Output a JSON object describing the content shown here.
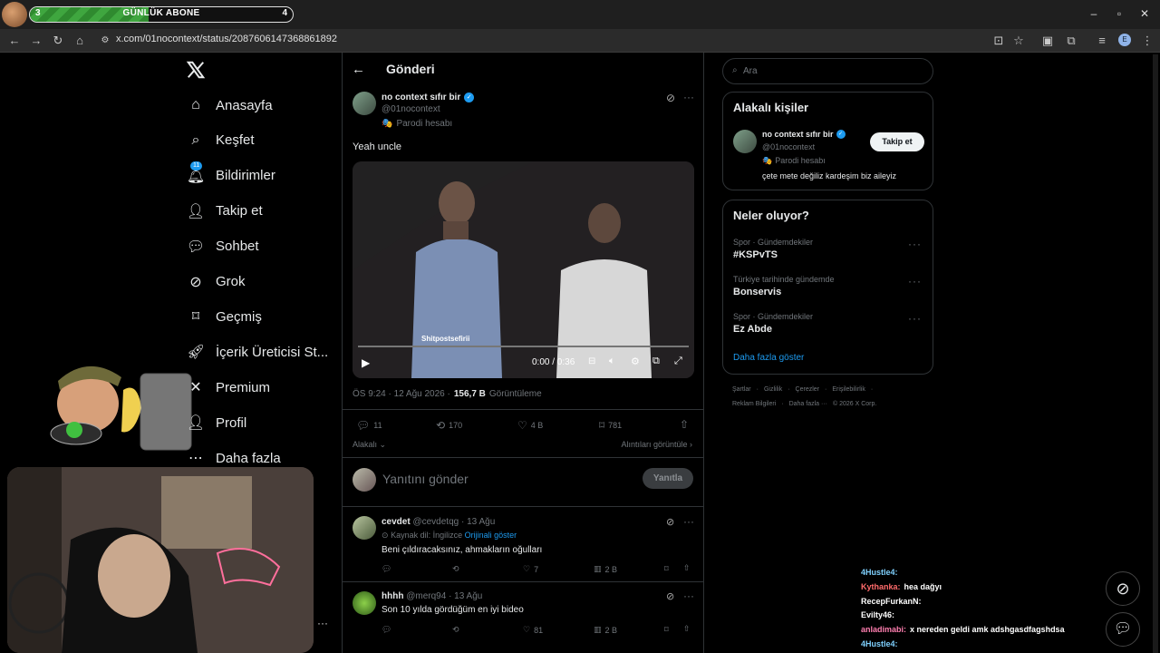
{
  "stream_overlay": {
    "sub_goal": {
      "label": "GÜNLÜK ABONE",
      "current": 3,
      "target": 4,
      "progress_fraction": 0.45
    }
  },
  "browser": {
    "url": "x.com/01nocontext/status/20876061473688618​92"
  },
  "nav": {
    "items": [
      {
        "label": "Anasayfa",
        "icon": "home-icon"
      },
      {
        "label": "Keşfet",
        "icon": "search-icon"
      },
      {
        "label": "Bildirimler",
        "icon": "bell-icon",
        "badge": "11"
      },
      {
        "label": "Takip et",
        "icon": "add-user-icon"
      },
      {
        "label": "Sohbet",
        "icon": "chat-icon"
      },
      {
        "label": "Grok",
        "icon": "grok-icon"
      },
      {
        "label": "Geçmiş",
        "icon": "bookmark-icon"
      },
      {
        "label": "İçerik Üreticisi St...",
        "icon": "rocket-icon"
      },
      {
        "label": "Premium",
        "icon": "x-icon"
      },
      {
        "label": "Profil",
        "icon": "person-icon"
      },
      {
        "label": "Daha fazla",
        "icon": "more-icon"
      }
    ]
  },
  "main": {
    "header_title": "Gönderi",
    "post": {
      "author_name": "no context sıfır bir",
      "handle": "@01nocontext",
      "parody_label": "Parodi hesabı",
      "text": "Yeah uncle",
      "video": {
        "watermark": "Shitpostsefirii",
        "time": "0:00 / 0:36"
      },
      "timestamp": "ÖS 9:24 · 12 Ağu 2026 ·",
      "views": "156,7 B",
      "views_label": "Görüntüleme",
      "stats": {
        "replies": "11",
        "reposts": "170",
        "likes": "4 B",
        "bookmarks": "781"
      },
      "related_label": "Alakalı",
      "quotes_label": "Alıntıları görüntüle"
    },
    "reply_box": {
      "placeholder": "Yanıtını gönder",
      "button": "Yanıtla"
    },
    "replies": [
      {
        "name": "cevdet",
        "handle": "@cevdetqg",
        "time": "· 13 Ağu",
        "translate_note": "Kaynak dil: İngilizce",
        "translate_link": "Orijinali göster",
        "text": "Beni çıldıracaksınız, ahmakların oğulları",
        "likes": "7",
        "views": "2 B"
      },
      {
        "name": "hhhh",
        "handle": "@merq94",
        "time": "· 13 Ağu",
        "text": "Son 10 yılda gördüğüm en iyi bideo",
        "likes": "81",
        "views": "2 B"
      }
    ]
  },
  "right": {
    "search_placeholder": "Ara",
    "related_people": {
      "title": "Alakalı kişiler",
      "name": "no context sıfır bir",
      "handle": "@01nocontext",
      "parody_label": "Parodi hesabı",
      "bio": "çete mete değiliz kardeşim biz aileyiz",
      "follow_button": "Takip et"
    },
    "trends": {
      "title": "Neler oluyor?",
      "items": [
        {
          "meta": "Spor · Gündemdekiler",
          "name": "#KSPvTS"
        },
        {
          "meta": "Türkiye tarihinde gündemde",
          "name": "Bonservis"
        },
        {
          "meta": "Spor · Gündemdekiler",
          "name": "Ez Abde"
        }
      ],
      "show_more": "Daha fazla göster"
    },
    "footer": {
      "links_row1": [
        "Şartlar",
        "·",
        "Gizlilik",
        "·",
        "Çerezler",
        "·",
        "Erişilebilirlik",
        "·"
      ],
      "links_row2": [
        "Reklam Bilgileri",
        "·",
        "Daha fazla ···",
        "© 2026 X Corp."
      ]
    }
  },
  "chat": [
    {
      "user": "4Hustle4:",
      "color": "#7fd1ff",
      "msg": ""
    },
    {
      "user": "Kythanka:",
      "color": "#ff6b6b",
      "msg": "hea dağyı"
    },
    {
      "user": "RecepFurkanN:",
      "color": "#ffffff",
      "msg": ""
    },
    {
      "user": "Evilty46:",
      "color": "#ffffff",
      "msg": ""
    },
    {
      "user": "anladimabi:",
      "color": "#ff7fb0",
      "msg": "x nereden geldi amk adshgasdfagshdsa"
    },
    {
      "user": "4Hustle4:",
      "color": "#7fd1ff",
      "msg": ""
    }
  ],
  "colors": {
    "accent": "#1d9bf0",
    "verified": "#1d9bf0",
    "text": "#e7e9ea",
    "muted": "#71767b",
    "border": "#2f3336"
  }
}
